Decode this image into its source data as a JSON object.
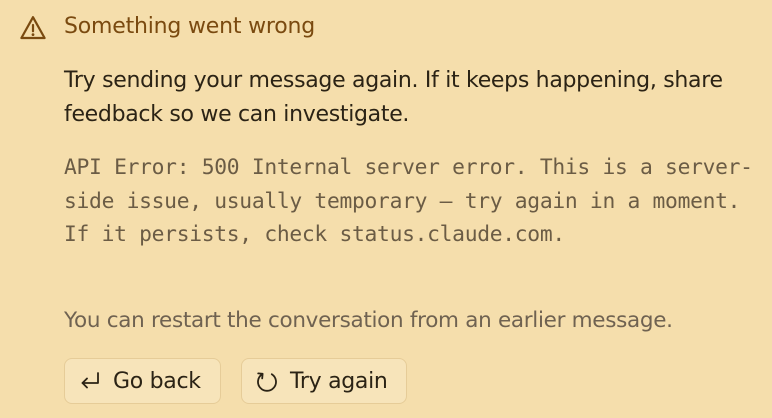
{
  "error_alert": {
    "icon": "warning-triangle-icon",
    "title": "Something went wrong",
    "message": "Try sending your message again. If it keeps happening, share feedback so we can investigate.",
    "error_detail": "API Error: 500 Internal server error. This is a server-side issue, usually temporary — try again in a moment. If it persists, check status.claude.com.",
    "hint": "You can restart the conversation from an earlier message.",
    "actions": {
      "go_back": {
        "label": "Go back",
        "icon": "return-arrow-icon"
      },
      "try_again": {
        "label": "Try again",
        "icon": "retry-arrow-icon"
      }
    }
  },
  "colors": {
    "background": "#f5deac",
    "title": "#7a4a10",
    "body_text": "#2b2315",
    "muted_text": "#6b5c45",
    "button_border": "#e6cc98"
  }
}
